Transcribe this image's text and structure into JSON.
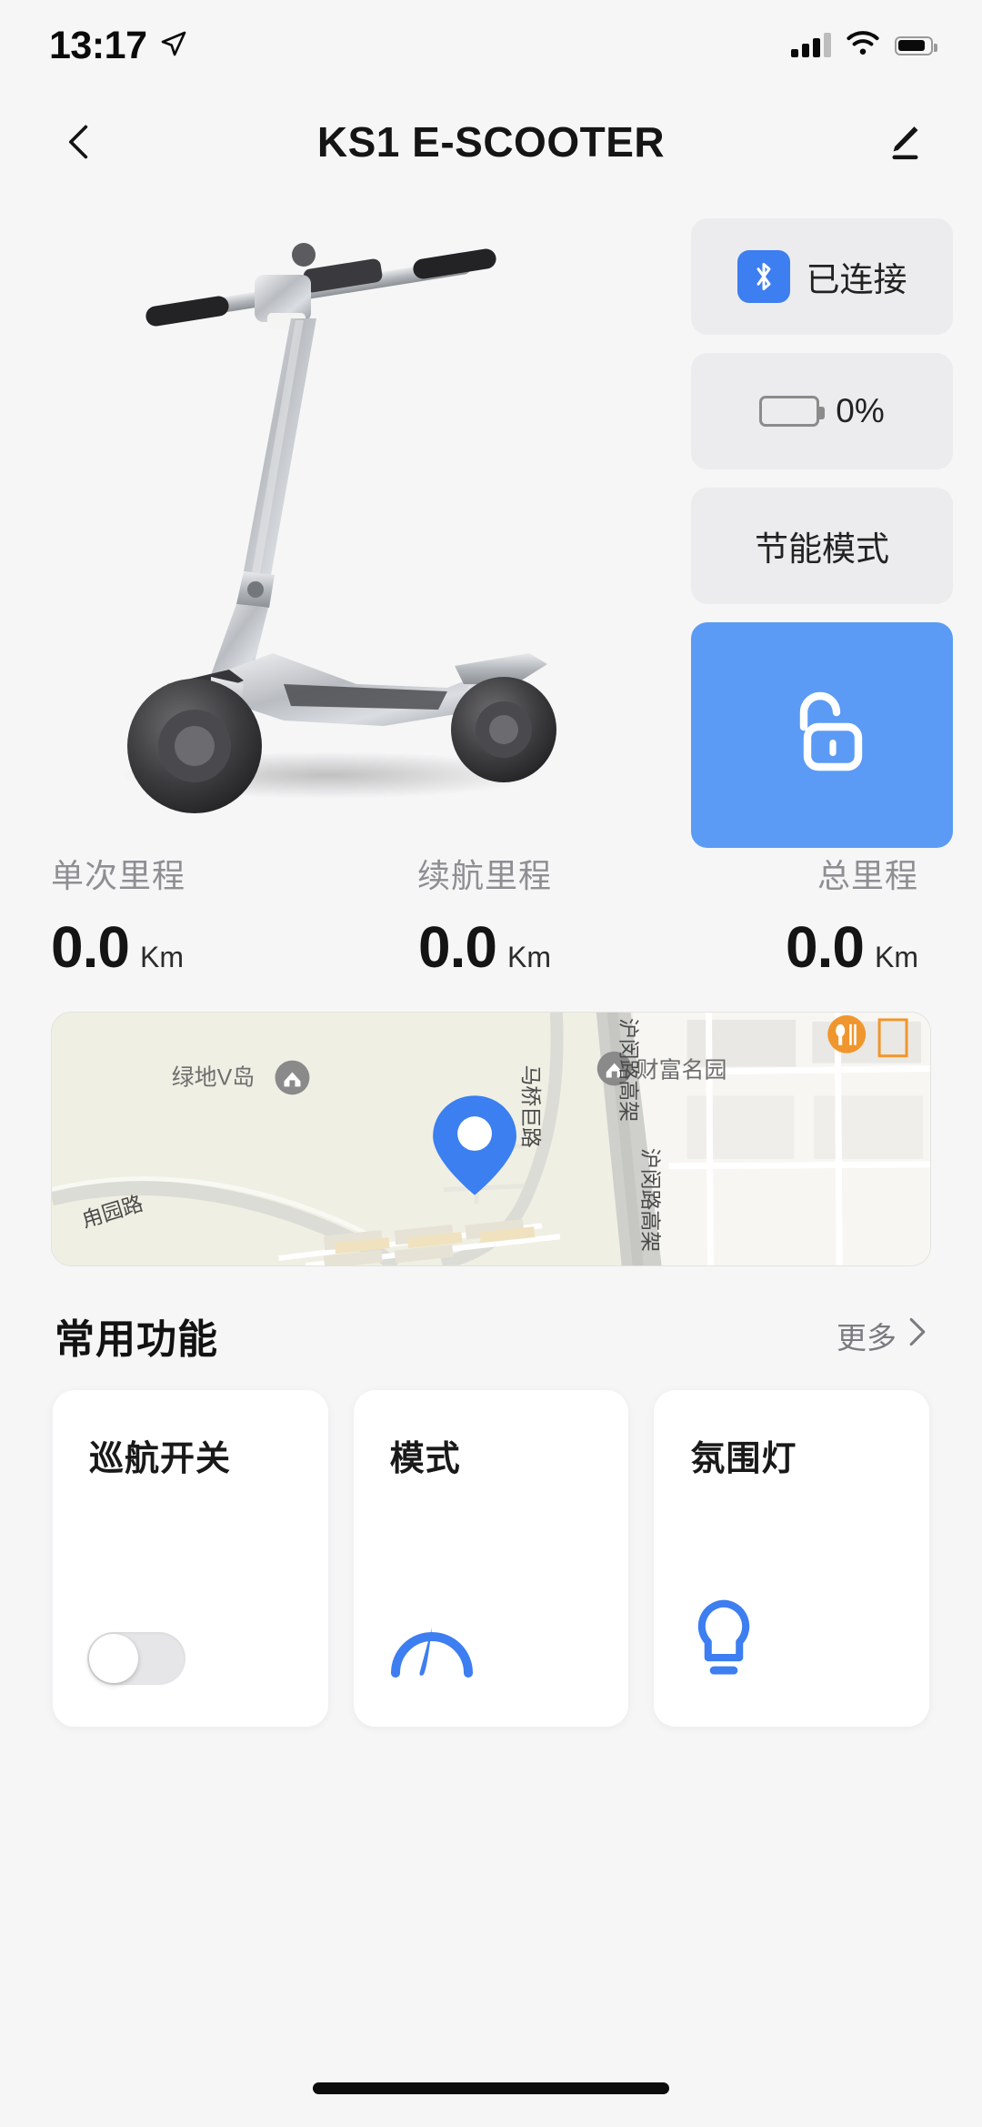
{
  "status_bar": {
    "time": "13:17",
    "location_icon": "location-arrow-icon",
    "signal_icon": "cellular-signal-icon",
    "wifi_icon": "wifi-icon",
    "battery_icon": "battery-icon"
  },
  "header": {
    "back_icon": "back-chevron-icon",
    "title": "KS1 E-SCOOTER",
    "edit_icon": "pencil-edit-icon"
  },
  "hero": {
    "product_image_alt": "silver electric scooter",
    "status_cards": [
      {
        "icon": "bluetooth-icon",
        "label": "已连接"
      },
      {
        "icon": "battery-outline-icon",
        "label": "0%"
      },
      {
        "icon": "",
        "label": "节能模式"
      }
    ],
    "lock_button": {
      "icon": "unlocked-padlock-icon",
      "color": "#5b9bf5"
    }
  },
  "stats": [
    {
      "title": "单次里程",
      "value": "0.0",
      "unit": "Km"
    },
    {
      "title": "续航里程",
      "value": "0.0",
      "unit": "Km"
    },
    {
      "title": "总里程",
      "value": "0.0",
      "unit": "Km"
    }
  ],
  "map": {
    "marker_icon": "location-pin-marker",
    "marker_color": "#3b7ff0",
    "pois": [
      {
        "name": "绿地V岛",
        "icon": "house-poi-icon"
      },
      {
        "name": "财富名园",
        "icon": "house-poi-icon"
      },
      {
        "name": "",
        "icon": "restaurant-poi-icon"
      }
    ],
    "roads": [
      {
        "name": "甪园路"
      },
      {
        "name": "马桥巨路"
      },
      {
        "name": "沪闵路高架"
      },
      {
        "name": "沪闵路高架"
      }
    ]
  },
  "section": {
    "title": "常用功能",
    "more_label": "更多",
    "more_icon": "chevron-right-icon"
  },
  "function_cards": [
    {
      "title": "巡航开关",
      "icon": "toggle-switch",
      "state": "off"
    },
    {
      "title": "模式",
      "icon": "speedometer-icon",
      "color": "#3d7ef0"
    },
    {
      "title": "氛围灯",
      "icon": "lightbulb-icon",
      "color": "#3d7ef0"
    }
  ],
  "colors": {
    "page_bg": "#f6f6f7",
    "card_bg": "#ececee",
    "accent_blue": "#3d7ef0",
    "lock_blue": "#5b9bf5",
    "muted_text": "#8e8e93"
  }
}
